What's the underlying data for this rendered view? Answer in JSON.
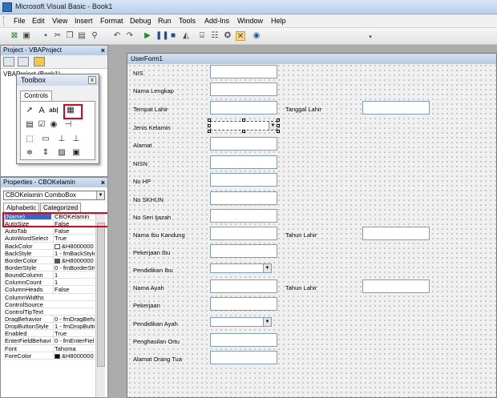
{
  "window": {
    "title": "Microsoft Visual Basic - Book1"
  },
  "menu": [
    "File",
    "Edit",
    "View",
    "Insert",
    "Format",
    "Debug",
    "Run",
    "Tools",
    "Add-Ins",
    "Window",
    "Help"
  ],
  "toolbar_icons": [
    "excel-icon",
    "insert-userform-icon",
    "save-icon",
    "cut-icon",
    "copy-icon",
    "paste-icon",
    "find-icon",
    "undo-icon",
    "redo-icon",
    "run-icon",
    "break-icon",
    "reset-icon",
    "design-mode-icon",
    "project-explorer-icon",
    "properties-window-icon",
    "object-browser-icon",
    "toolbox-icon",
    "help-icon"
  ],
  "project": {
    "title": "Project - VBAProject",
    "tree_item": "VBAProject (Book1)"
  },
  "toolbox": {
    "title": "Toolbox",
    "tab": "Controls",
    "close": "x"
  },
  "properties": {
    "title": "Properties - CBOKelamin",
    "object": "CBOKelamin ComboBox",
    "tabs": [
      "Alphabetic",
      "Categorized"
    ],
    "rows": [
      {
        "name": "(Name)",
        "value": "CBOKelamin"
      },
      {
        "name": "AutoSize",
        "value": "False"
      },
      {
        "name": "AutoTab",
        "value": "False"
      },
      {
        "name": "AutoWordSelect",
        "value": "True"
      },
      {
        "name": "BackColor",
        "value": "&H8000000"
      },
      {
        "name": "BackStyle",
        "value": "1 - fmBackStyle"
      },
      {
        "name": "BorderColor",
        "value": "&H8000000"
      },
      {
        "name": "BorderStyle",
        "value": "0 - fmBorderSty"
      },
      {
        "name": "BoundColumn",
        "value": "1"
      },
      {
        "name": "ColumnCount",
        "value": "1"
      },
      {
        "name": "ColumnHeads",
        "value": "False"
      },
      {
        "name": "ColumnWidths",
        "value": ""
      },
      {
        "name": "ControlSource",
        "value": ""
      },
      {
        "name": "ControlTipText",
        "value": ""
      },
      {
        "name": "DragBehavior",
        "value": "0 - fmDragBeha"
      },
      {
        "name": "DropButtonStyle",
        "value": "1 - fmDropButto"
      },
      {
        "name": "Enabled",
        "value": "True"
      },
      {
        "name": "EnterFieldBehavi",
        "value": "0 - fmEnterFiel"
      },
      {
        "name": "Font",
        "value": "Tahoma"
      },
      {
        "name": "ForeColor",
        "value": "&H8000000"
      }
    ],
    "swatches": {
      "BackColor": "#ffffff",
      "BorderColor": "#555555",
      "ForeColor": "#000000"
    }
  },
  "userform": {
    "caption": "UserForm1",
    "labels": [
      "NIS",
      "Nama Lengkap",
      "Tempat Lahir",
      "Tanggal Lahir",
      "Jenis Kelamin",
      "Alamat",
      "NISN",
      "No HP",
      "No SKHUN",
      "No Seri Ijazah",
      "Nama Ibu Kandung",
      "Tahun Lahir",
      "Pekerjaan Ibu",
      "Pendidikan Ibu",
      "Nama Ayah",
      "Tahun Lahir",
      "Pekerjaan",
      "Pendidikan Ayah",
      "Penghasilan Ortu",
      "Alamat Orang Tua"
    ]
  },
  "colors": {
    "highlight": "#e3001b",
    "selection": "#316ac5"
  }
}
